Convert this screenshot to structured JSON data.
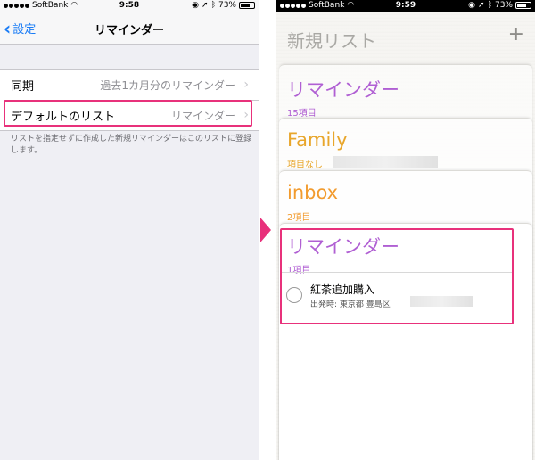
{
  "left": {
    "status": {
      "carrier": "SoftBank",
      "time": "9:58",
      "battery": "73%"
    },
    "nav": {
      "back_label": "設定",
      "title": "リマインダー"
    },
    "rows": [
      {
        "label": "同期",
        "value": "過去1カ月分のリマインダー"
      },
      {
        "label": "デフォルトのリスト",
        "value": "リマインダー"
      }
    ],
    "footnote": "リストを指定せずに作成した新規リマインダーはこのリストに登録します。"
  },
  "right": {
    "status": {
      "carrier": "SoftBank",
      "time": "9:59",
      "battery": "73%"
    },
    "header": {
      "title": "新規リスト",
      "plus": "+"
    },
    "lists": [
      {
        "title": "リマインダー",
        "count": "15項目",
        "color": "#b05fd3"
      },
      {
        "title": "Family",
        "count": "項目なし",
        "color": "#e8a62b"
      },
      {
        "title": "inbox",
        "count": "2項目",
        "color": "#f29b2e"
      },
      {
        "title": "リマインダー",
        "count": "1項目",
        "color": "#b05fd3"
      }
    ],
    "item": {
      "title": "紅茶追加購入",
      "subtitle": "出発時: 東京都 豊島区"
    }
  },
  "accent": {
    "highlight": "#e8317b",
    "ios_blue": "#1a7cf5"
  },
  "icons": [
    "signal-dots-icon",
    "wifi-icon",
    "lock-rotation-icon",
    "location-icon",
    "bluetooth-icon",
    "battery-icon",
    "back-chevron-icon",
    "disclosure-chevron-icon",
    "plus-icon",
    "checkbox-circle-icon",
    "pointer-arrow-icon"
  ]
}
